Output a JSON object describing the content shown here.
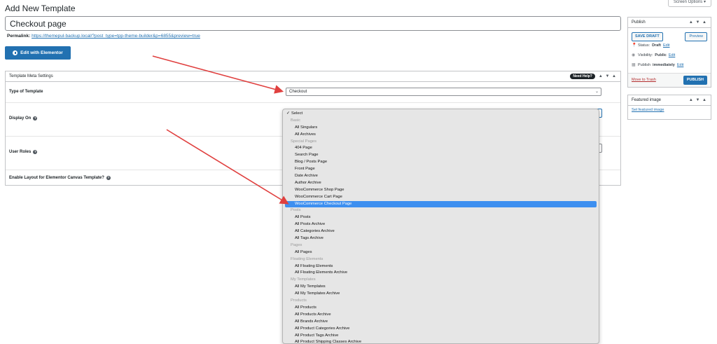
{
  "page": {
    "heading": "Add New Template",
    "screen_options": "Screen Options ▾"
  },
  "editor": {
    "title_value": "Checkout page",
    "permalink_label": "Permalink:",
    "permalink_url": "https://themepul-backup.local/?post_type=tpp-theme-builder&p=6855&preview=true",
    "elementor_button": "Edit with Elementor"
  },
  "meta_box": {
    "title": "Template Meta Settings",
    "need_help": "Need Help?",
    "controls": "▲ ▼ ▲",
    "rows": {
      "type_label": "Type of Template",
      "type_value": "Checkout",
      "display_label": "Display On",
      "roles_label": "User Roles",
      "canvas_label": "Enable Layout for Elementor Canvas Template?"
    }
  },
  "dropdown": {
    "checked_label": "Select",
    "checkmark": "✓",
    "items": [
      {
        "text": "Basic",
        "group": true
      },
      {
        "text": "All Singulars"
      },
      {
        "text": "All Archives"
      },
      {
        "text": "Special Pages",
        "group": true
      },
      {
        "text": "404 Page"
      },
      {
        "text": "Search Page"
      },
      {
        "text": "Blog / Posts Page"
      },
      {
        "text": "Front Page"
      },
      {
        "text": "Date Archive"
      },
      {
        "text": "Author Archive"
      },
      {
        "text": "WooCommerce Shop Page"
      },
      {
        "text": "WooCommerce Cart Page"
      },
      {
        "text": "WooCommerce Checkout Page",
        "highlighted": true
      },
      {
        "text": "Posts",
        "group": true
      },
      {
        "text": "All Posts"
      },
      {
        "text": "All Posts Archive"
      },
      {
        "text": "All Categories Archive"
      },
      {
        "text": "All Tags Archive"
      },
      {
        "text": "Pages",
        "group": true
      },
      {
        "text": "All Pages"
      },
      {
        "text": "Floating Elements",
        "group": true
      },
      {
        "text": "All Floating Elements"
      },
      {
        "text": "All Floating Elements Archive"
      },
      {
        "text": "My Templates",
        "group": true
      },
      {
        "text": "All My Templates"
      },
      {
        "text": "All My Templates Archive"
      },
      {
        "text": "Products",
        "group": true
      },
      {
        "text": "All Products"
      },
      {
        "text": "All Products Archive"
      },
      {
        "text": "All Brands Archive"
      },
      {
        "text": "All Product Categories Archive"
      },
      {
        "text": "All Product Tags Archive"
      },
      {
        "text": "All Product Shipping Classes Archive"
      }
    ]
  },
  "publish": {
    "title": "Publish",
    "controls": "▲ ▼ ▲",
    "save_draft": "SAVE DRAFT",
    "preview": "Preview",
    "status_label": "Status:",
    "status_value": "Draft",
    "visibility_label": "Visibility:",
    "visibility_value": "Public",
    "publish_label": "Publish",
    "publish_value": "immediately",
    "edit": "Edit",
    "trash": "Move to Trash",
    "publish_button": "PUBLISH"
  },
  "featured": {
    "title": "Featured image",
    "controls": "▲ ▼ ▲",
    "link": "Set featured image"
  },
  "colors": {
    "accent": "#2271b1",
    "annotation_arrow": "#e0403f",
    "highlight": "#3d8ff0"
  }
}
